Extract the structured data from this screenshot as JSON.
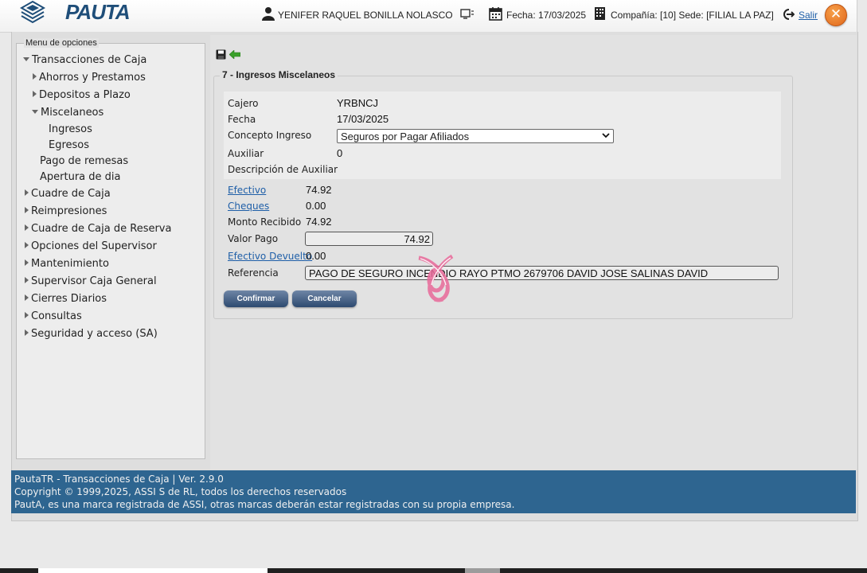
{
  "header": {
    "logo_text": "PAUTA",
    "user_name": "YENIFER RAQUEL BONILLA NOLASCO",
    "date_label": "Fecha: 17/03/2025",
    "company_label": "Compañía: [10] Sede: [FILIAL LA PAZ]",
    "logout_label": "Salir",
    "close_symbol": "✕"
  },
  "sidebar": {
    "legend": "Menu de opciones",
    "items": [
      {
        "label": "Transacciones de Caja",
        "state": "expanded"
      },
      {
        "label": "Ahorros y Prestamos",
        "state": "collapsed"
      },
      {
        "label": "Depositos a Plazo",
        "state": "collapsed"
      },
      {
        "label": "Miscelaneos",
        "state": "expanded"
      },
      {
        "label": "Ingresos",
        "state": "leaf"
      },
      {
        "label": "Egresos",
        "state": "leaf"
      },
      {
        "label": "Pago de remesas",
        "state": "leaf"
      },
      {
        "label": "Apertura de dia",
        "state": "leaf"
      },
      {
        "label": "Cuadre de Caja",
        "state": "collapsed"
      },
      {
        "label": "Reimpresiones",
        "state": "collapsed"
      },
      {
        "label": "Cuadre de Caja de Reserva",
        "state": "collapsed"
      },
      {
        "label": "Opciones del Supervisor",
        "state": "collapsed"
      },
      {
        "label": "Mantenimiento",
        "state": "collapsed"
      },
      {
        "label": "Supervisor Caja General",
        "state": "collapsed"
      },
      {
        "label": "Cierres Diarios",
        "state": "collapsed"
      },
      {
        "label": "Consultas",
        "state": "collapsed"
      },
      {
        "label": "Seguridad y acceso (SA)",
        "state": "collapsed"
      }
    ]
  },
  "form": {
    "legend": "7 - Ingresos Miscelaneos",
    "cajero_label": "Cajero",
    "cajero_value": "YRBNCJ",
    "fecha_label": "Fecha",
    "fecha_value": "17/03/2025",
    "concepto_label": "Concepto Ingreso",
    "concepto_value": "Seguros por Pagar Afiliados",
    "auxiliar_label": "Auxiliar",
    "auxiliar_value": "0",
    "descripcion_label": "Descripción de Auxiliar",
    "descripcion_value": "",
    "efectivo_label": "Efectivo",
    "efectivo_value": "74.92",
    "cheques_label": "Cheques",
    "cheques_value": "0.00",
    "monto_label": "Monto Recibido",
    "monto_value": "74.92",
    "valor_label": "Valor Pago",
    "valor_value": "74.92",
    "devuelto_label": "Efectivo Devuelto",
    "devuelto_value": "0.00",
    "referencia_label": "Referencia",
    "referencia_value": "PAGO DE SEGURO INCENDIO RAYO PTMO 2679706 DAVID JOSE SALINAS DAVID",
    "confirm_label": "Confirmar",
    "cancel_label": "Cancelar"
  },
  "footer": {
    "line1": "PautaTR - Transacciones de Caja | Ver. 2.9.0",
    "line2": "Copyright © 1999,2025, ASSI S de RL, todos los derechos reservados",
    "line3": "PautA, es una marca registrada de ASSI, otras marcas deberán estar registradas con su propia empresa."
  },
  "colors": {
    "footer_bg": "#2e6590",
    "button_bg": "#2d4a70",
    "link": "#1f5fa8",
    "close_button": "#e0661b"
  },
  "icons": [
    "logo-icon",
    "user-icon",
    "terminal-icon",
    "calendar-icon",
    "building-icon",
    "logout-icon",
    "close-icon",
    "save-icon",
    "back-arrow-icon",
    "chevron-down-icon",
    "loading-spinner-icon"
  ]
}
